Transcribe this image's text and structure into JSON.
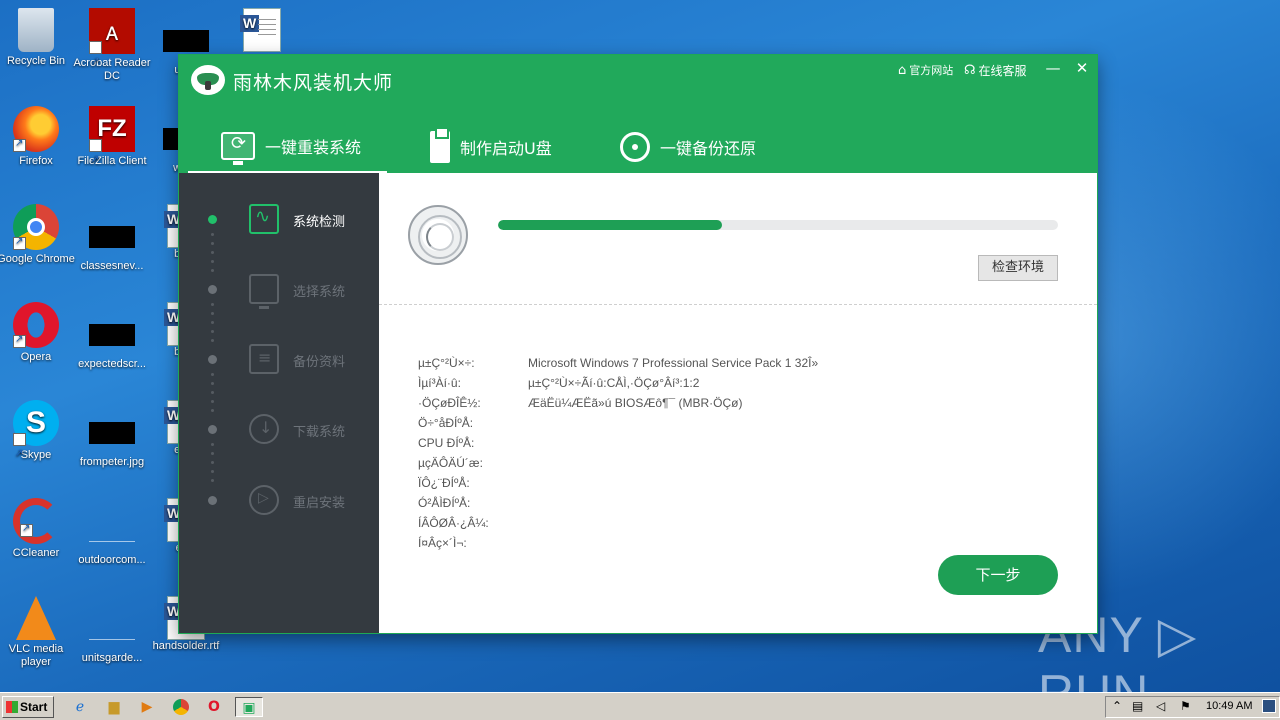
{
  "desktop": {
    "icons": [
      {
        "label": "Recycle Bin"
      },
      {
        "label": "Acrobat Reader DC"
      },
      {
        "label": "usec"
      },
      {
        "label": "Firefox"
      },
      {
        "label": "FileZilla Client"
      },
      {
        "label": "worki"
      },
      {
        "label": "Google Chrome"
      },
      {
        "label": "classesnev..."
      },
      {
        "label": "beyo"
      },
      {
        "label": "Opera"
      },
      {
        "label": "expectedscr..."
      },
      {
        "label": "beyo"
      },
      {
        "label": "Skype"
      },
      {
        "label": "frompeter.jpg"
      },
      {
        "label": "elser"
      },
      {
        "label": "CCleaner"
      },
      {
        "label": "outdoorcom..."
      },
      {
        "label": "engi"
      },
      {
        "label": "VLC media player"
      },
      {
        "label": "unitsgarde..."
      },
      {
        "label": "handsolder.rtf"
      }
    ]
  },
  "app": {
    "title": "雨林木风装机大师",
    "top_links": {
      "official_site": "官方网站",
      "online_service": "在线客服"
    },
    "window_buttons": {
      "minimize": "—",
      "close": "✕"
    },
    "tabs": [
      {
        "label": "一键重装系统",
        "active": true
      },
      {
        "label": "制作启动U盘",
        "active": false
      },
      {
        "label": "一键备份还原",
        "active": false
      }
    ],
    "steps": [
      {
        "label": "系统检测",
        "active": true
      },
      {
        "label": "选择系统",
        "active": false
      },
      {
        "label": "备份资料",
        "active": false
      },
      {
        "label": "下载系统",
        "active": false
      },
      {
        "label": "重启安装",
        "active": false
      }
    ],
    "progress": 0.4,
    "check_button": "检查环境",
    "info_rows": [
      {
        "key": "µ±Ç°²Ù×÷:",
        "value": "Microsoft Windows 7 Professional Service Pack 1 32Î»"
      },
      {
        "key": "Ìµí³Àí·û:",
        "value": "µ±Ç°²Ù×÷Ãí·û:CÅÌ,·ÖÇø°Âí³:1:2"
      },
      {
        "key": "·ÖÇøÐÎÊ½:",
        "value": "ÆäËü¼ÆËã»ú BIOSÆô¶¯ (MBR·ÖÇø)"
      },
      {
        "key": "Ö÷°åÐÍºÅ:",
        "value": ""
      },
      {
        "key": "CPU ÐÍºÅ:",
        "value": ""
      },
      {
        "key": "µçÄÔÄÚ´æ:",
        "value": ""
      },
      {
        "key": "ÏÔ¿¨ÐÍºÅ:",
        "value": ""
      },
      {
        "key": "Ó²ÅÌÐÍºÅ:",
        "value": ""
      },
      {
        "key": "ÍÂÔØÂ·¿Â¼:",
        "value": ""
      },
      {
        "key": "Í¤Âç×´Ì¬:",
        "value": ""
      }
    ],
    "next_button": "下一步"
  },
  "watermark": "ANY ▷ RUN",
  "taskbar": {
    "start_label": "Start",
    "clock": "10:49 AM"
  },
  "colors": {
    "brand_green": "#21a95b",
    "sidebar_dark": "#343a40",
    "progress_green": "#1e9f55"
  }
}
